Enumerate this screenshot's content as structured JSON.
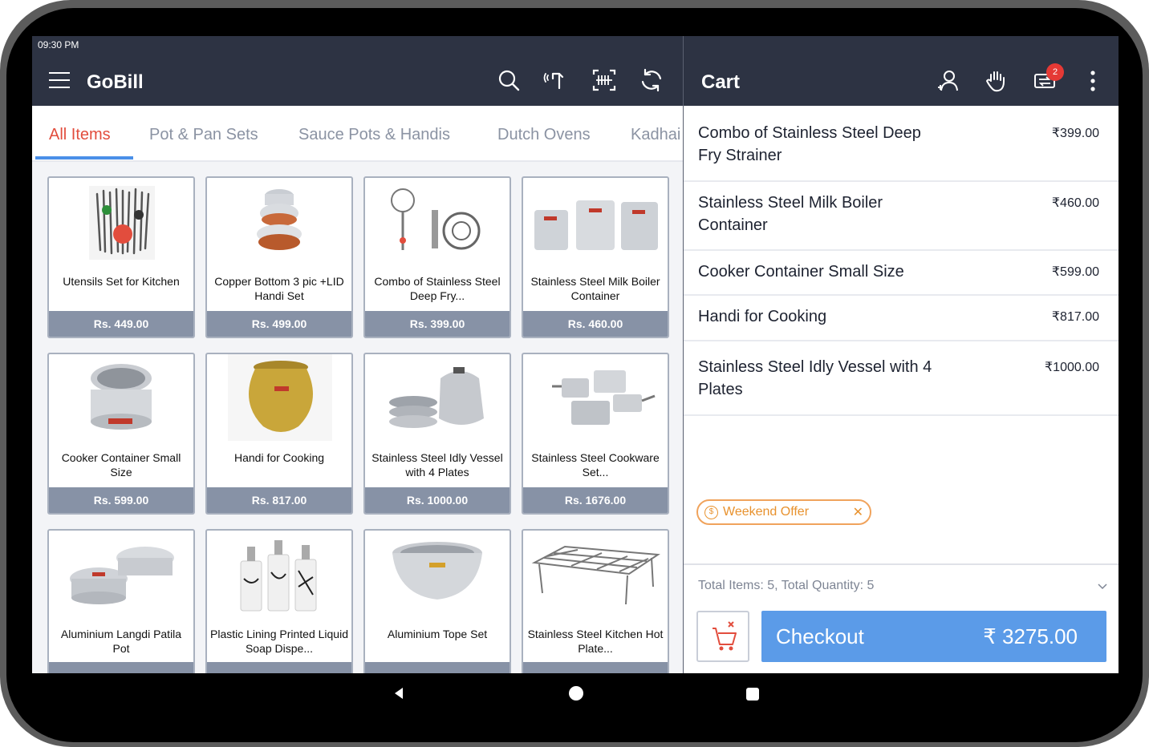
{
  "status": {
    "time": "09:30 PM"
  },
  "app": {
    "title": "GoBill"
  },
  "tabs": [
    {
      "label": "All Items",
      "active": true
    },
    {
      "label": "Pot & Pan Sets"
    },
    {
      "label": "Sauce Pots & Handis"
    },
    {
      "label": "Dutch Ovens"
    },
    {
      "label": "Kadhai"
    }
  ],
  "products": [
    {
      "name": "Utensils Set for Kitchen",
      "price": "Rs. 449.00"
    },
    {
      "name": "Copper Bottom 3 pic +LID Handi Set",
      "price": "Rs. 499.00"
    },
    {
      "name": "Combo of Stainless Steel Deep Fry...",
      "price": "Rs. 399.00"
    },
    {
      "name": "Stainless Steel Milk Boiler Container",
      "price": "Rs. 460.00"
    },
    {
      "name": "Cooker Container Small Size",
      "price": "Rs. 599.00"
    },
    {
      "name": "Handi for Cooking",
      "price": "Rs. 817.00"
    },
    {
      "name": "Stainless Steel Idly Vessel with 4 Plates",
      "price": "Rs. 1000.00"
    },
    {
      "name": "Stainless Steel Cookware Set...",
      "price": "Rs. 1676.00"
    },
    {
      "name": "Aluminium Langdi Patila Pot",
      "price": ""
    },
    {
      "name": "Plastic Lining Printed Liquid Soap Dispe...",
      "price": ""
    },
    {
      "name": "Aluminium Tope Set",
      "price": ""
    },
    {
      "name": "Stainless Steel Kitchen Hot Plate...",
      "price": ""
    }
  ],
  "cart": {
    "title": "Cart",
    "notification_count": "2",
    "items": [
      {
        "name": "Combo of Stainless Steel Deep Fry Strainer",
        "price": "₹399.00"
      },
      {
        "name": "Stainless Steel Milk Boiler Container",
        "price": "₹460.00"
      },
      {
        "name": "Cooker Container Small Size",
        "price": "₹599.00"
      },
      {
        "name": "Handi for Cooking",
        "price": "₹817.00"
      },
      {
        "name": "Stainless Steel Idly Vessel with 4 Plates",
        "price": "₹1000.00"
      }
    ],
    "offer": "Weekend Offer",
    "totals_text": "Total Items: 5, Total Quantity: 5",
    "checkout_label": "Checkout",
    "checkout_amount": "₹ 3275.00"
  },
  "colors": {
    "header": "#2d3343",
    "active_tab": "#e24d3d",
    "accent": "#5b9be8",
    "price_bar": "#8792a6",
    "offer": "#e8922e"
  },
  "icons": [
    "menu-icon",
    "search-icon",
    "barcode-scan-icon",
    "qr-scan-icon",
    "refresh-icon",
    "customer-icon",
    "hold-hand-icon",
    "swap-orders-icon",
    "more-vertical-icon",
    "cart-clear-icon",
    "offer-icon",
    "close-icon",
    "chevron-down-icon",
    "back-icon",
    "home-icon",
    "recents-icon"
  ]
}
